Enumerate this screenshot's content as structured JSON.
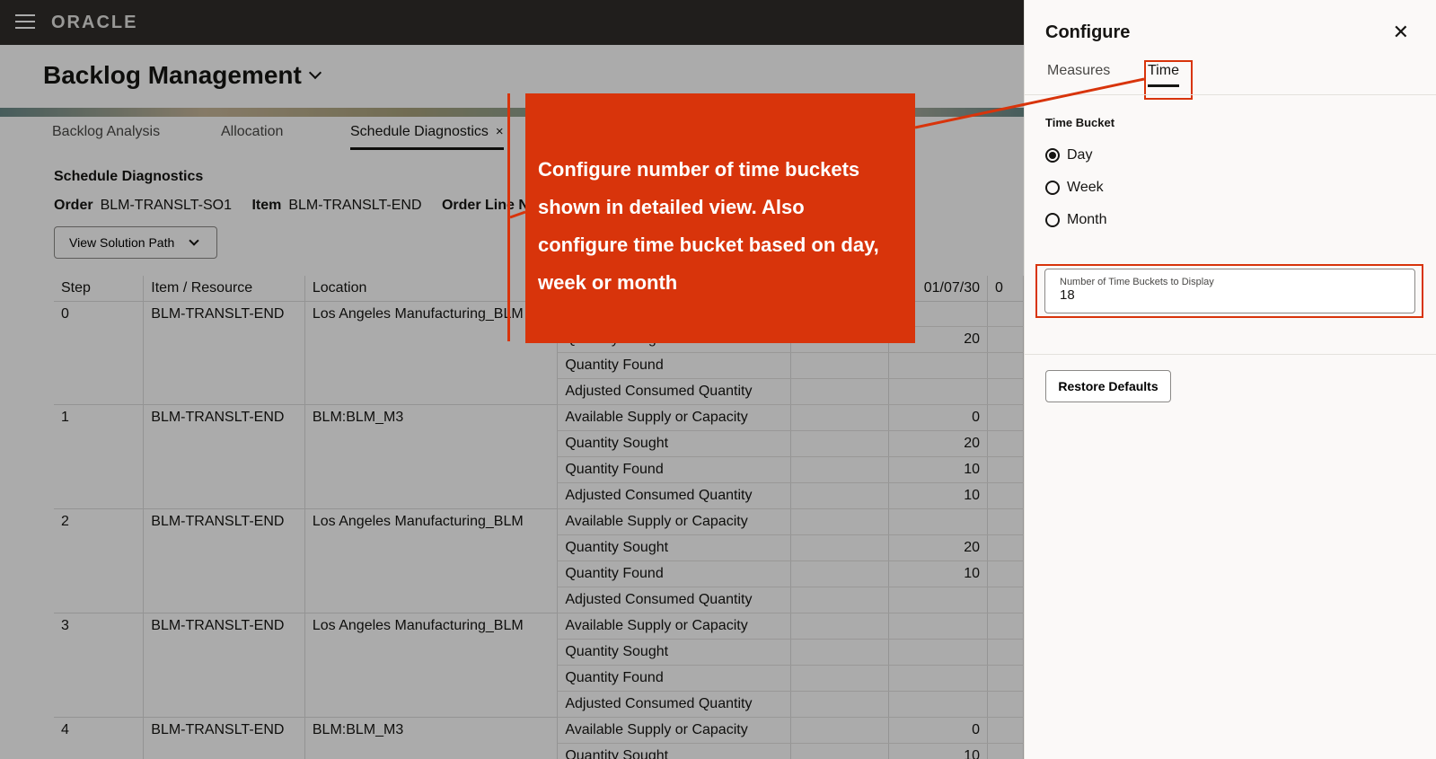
{
  "header": {
    "logo": "ORACLE"
  },
  "page": {
    "title": "Backlog Management",
    "tabs": [
      {
        "label": "Backlog Analysis"
      },
      {
        "label": "Allocation"
      },
      {
        "label": "Schedule Diagnostics",
        "close": "×"
      }
    ],
    "section_title": "Schedule Diagnostics",
    "order_label": "Order",
    "order_value": "BLM-TRANSLT-SO1",
    "item_label": "Item",
    "item_value": "BLM-TRANSLT-END",
    "order_line_label": "Order Line Nu",
    "solution_button": "View Solution Path"
  },
  "table": {
    "headers": [
      "Step",
      "Item / Resource",
      "Location",
      "",
      "",
      "01/07/30",
      "0"
    ],
    "steps": [
      {
        "step": "0",
        "item": "BLM-TRANSLT-END",
        "location": "Los Angeles Manufacturing_BLM",
        "rows": [
          {
            "measure": "",
            "value": ""
          },
          {
            "measure": "Quantity Sought",
            "value": "20"
          },
          {
            "measure": "Quantity Found",
            "value": ""
          },
          {
            "measure": "Adjusted Consumed Quantity",
            "value": ""
          }
        ]
      },
      {
        "step": "1",
        "item": "BLM-TRANSLT-END",
        "location": "BLM:BLM_M3",
        "rows": [
          {
            "measure": "Available Supply or Capacity",
            "value": "0"
          },
          {
            "measure": "Quantity Sought",
            "value": "20"
          },
          {
            "measure": "Quantity Found",
            "value": "10"
          },
          {
            "measure": "Adjusted Consumed Quantity",
            "value": "10"
          }
        ]
      },
      {
        "step": "2",
        "item": "BLM-TRANSLT-END",
        "location": "Los Angeles Manufacturing_BLM",
        "rows": [
          {
            "measure": "Available Supply or Capacity",
            "value": ""
          },
          {
            "measure": "Quantity Sought",
            "value": "20"
          },
          {
            "measure": "Quantity Found",
            "value": "10"
          },
          {
            "measure": "Adjusted Consumed Quantity",
            "value": ""
          }
        ]
      },
      {
        "step": "3",
        "item": "BLM-TRANSLT-END",
        "location": "Los Angeles Manufacturing_BLM",
        "rows": [
          {
            "measure": "Available Supply or Capacity",
            "value": ""
          },
          {
            "measure": "Quantity Sought",
            "value": ""
          },
          {
            "measure": "Quantity Found",
            "value": ""
          },
          {
            "measure": "Adjusted Consumed Quantity",
            "value": ""
          }
        ]
      },
      {
        "step": "4",
        "item": "BLM-TRANSLT-END",
        "location": "BLM:BLM_M3",
        "rows": [
          {
            "measure": "Available Supply or Capacity",
            "value": "0"
          },
          {
            "measure": "Quantity Sought",
            "value": "10"
          }
        ]
      }
    ]
  },
  "callout": {
    "lines": [
      "Configure number of time buckets",
      "shown in detailed view. Also",
      "configure time bucket based on day,",
      "week or month"
    ],
    "color": "#d8340b"
  },
  "panel": {
    "title": "Configure",
    "close": "✕",
    "tabs": [
      {
        "label": "Measures"
      },
      {
        "label": "Time"
      }
    ],
    "time_bucket_label": "Time Bucket",
    "options": [
      {
        "label": "Day",
        "checked": true
      },
      {
        "label": "Week",
        "checked": false
      },
      {
        "label": "Month",
        "checked": false
      }
    ],
    "buckets_label": "Number of Time Buckets to Display",
    "buckets_value": "18",
    "restore_button": "Restore Defaults"
  }
}
